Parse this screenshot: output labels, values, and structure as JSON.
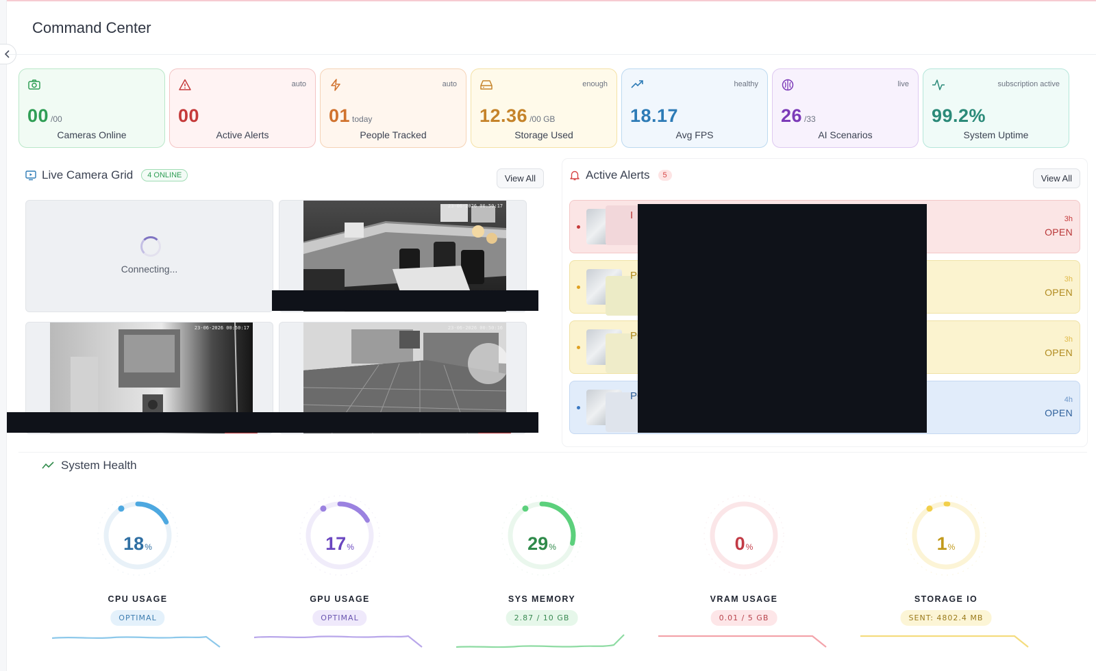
{
  "page": {
    "title": "Command Center"
  },
  "stats": [
    {
      "value": "00",
      "unit": "/00",
      "label": "Cameras Online",
      "tag": "",
      "icon": "camera-icon",
      "accent": "#2f9e55",
      "bg": "#f1fbf4",
      "border": "#b9e7c8"
    },
    {
      "value": "00",
      "unit": "",
      "label": "Active Alerts",
      "tag": "auto",
      "icon": "alert-triangle-icon",
      "accent": "#c53a3a",
      "bg": "#fff3f3",
      "border": "#f3c4c4"
    },
    {
      "value": "01",
      "unit": "today",
      "label": "People Tracked",
      "tag": "auto",
      "icon": "lightning-icon",
      "accent": "#d0722e",
      "bg": "#fff6ee",
      "border": "#f5d3b6"
    },
    {
      "value": "12.36",
      "unit": "/00 GB",
      "label": "Storage Used",
      "tag": "enough",
      "icon": "hard-drive-icon",
      "accent": "#c5832a",
      "bg": "#fffaea",
      "border": "#f4e1a6"
    },
    {
      "value": "18.17",
      "unit": "",
      "label": "Avg FPS",
      "tag": "healthy",
      "icon": "trending-up-icon",
      "accent": "#2d7bb6",
      "bg": "#f1f7fd",
      "border": "#bcd9f0"
    },
    {
      "value": "26",
      "unit": "/33",
      "label": "AI Scenarios",
      "tag": "live",
      "icon": "brain-icon",
      "accent": "#7c3bb8",
      "bg": "#f8f2fd",
      "border": "#dec9f1"
    },
    {
      "value": "99.2%",
      "unit": "",
      "label": "System Uptime",
      "tag": "subscription active",
      "icon": "activity-icon",
      "accent": "#2b8a79",
      "bg": "#f0fbf8",
      "border": "#b5e6da"
    }
  ],
  "camera_panel": {
    "title": "Live Camera Grid",
    "badge": "4 ONLINE",
    "view_all": "View All",
    "connecting": "Connecting...",
    "stamps": [
      "",
      "23-06-2026 00:50:17",
      "23-06-2026 00:50:17",
      "23-06-2026 00:50:16"
    ]
  },
  "alerts_panel": {
    "title": "Active Alerts",
    "count": "5",
    "view_all": "View All",
    "items": [
      {
        "name": "I",
        "time": "3h",
        "status": "OPEN",
        "bg": "#fbe5e5",
        "border": "#f3c7c7",
        "color": "#b83535"
      },
      {
        "name": "POI",
        "time": "3h",
        "status": "OPEN",
        "bg": "#fbf3cf",
        "border": "#f0e2a5",
        "color": "#b08a1f"
      },
      {
        "name": "POI",
        "time": "3h",
        "status": "OPEN",
        "bg": "#fbf3cf",
        "border": "#f0e2a5",
        "color": "#b08a1f"
      },
      {
        "name": "POI",
        "time": "4h",
        "status": "OPEN",
        "bg": "#e1ecfa",
        "border": "#c4d8f2",
        "color": "#2d5f9a"
      }
    ]
  },
  "health": {
    "title": "System Health",
    "gauges": [
      {
        "value": "18",
        "unit": "%",
        "label": "CPU USAGE",
        "pill": "OPTIMAL",
        "percent": 18,
        "color": "#4da8e0",
        "text": "#2f6fa3",
        "pill_bg": "#e4f1fb",
        "pill_color": "#3d7db0"
      },
      {
        "value": "17",
        "unit": "%",
        "label": "GPU USAGE",
        "pill": "OPTIMAL",
        "percent": 17,
        "color": "#9b82e0",
        "text": "#6a46c0",
        "pill_bg": "#efe9fb",
        "pill_color": "#6a55b0"
      },
      {
        "value": "29",
        "unit": "%",
        "label": "SYS MEMORY",
        "pill": "2.87 / 10 GB",
        "percent": 29,
        "color": "#5cd07c",
        "text": "#2f8a4a",
        "pill_bg": "#e6f7ea",
        "pill_color": "#3a8a52"
      },
      {
        "value": "0",
        "unit": "%",
        "label": "VRAM USAGE",
        "pill": "0.01 / 5 GB",
        "percent": 0,
        "color": "#f08a92",
        "text": "#c23a45",
        "pill_bg": "#fde6e8",
        "pill_color": "#b8434c"
      },
      {
        "value": "1",
        "unit": "%",
        "label": "STORAGE IO",
        "pill": "SENT: 4802.4 MB",
        "percent": 1,
        "color": "#f2cf4a",
        "text": "#c29a1c",
        "pill_bg": "#fcf5d6",
        "pill_color": "#9a7a1a"
      }
    ]
  }
}
